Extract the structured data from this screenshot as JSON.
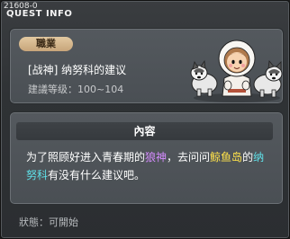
{
  "header": {
    "quest_id": "21608-0",
    "title": "QUEST INFO"
  },
  "quest": {
    "category": "職業",
    "name": "[战神] 纳努科的建议",
    "level": "建議等级：100~104"
  },
  "content": {
    "header": "內容",
    "parts": [
      {
        "text": "为了照顾好进入青春期的",
        "style": "normal"
      },
      {
        "text": "狼神",
        "style": "purple"
      },
      {
        "text": "，去问问",
        "style": "normal"
      },
      {
        "text": "鲸鱼岛",
        "style": "yellow"
      },
      {
        "text": "的",
        "style": "normal"
      },
      {
        "text": "纳努科",
        "style": "cyan"
      },
      {
        "text": "有没有什么建议吧。",
        "style": "normal"
      }
    ]
  },
  "status": "狀態：可開始",
  "npc": {
    "icon": "npc-eskimo-with-husky-dogs"
  }
}
